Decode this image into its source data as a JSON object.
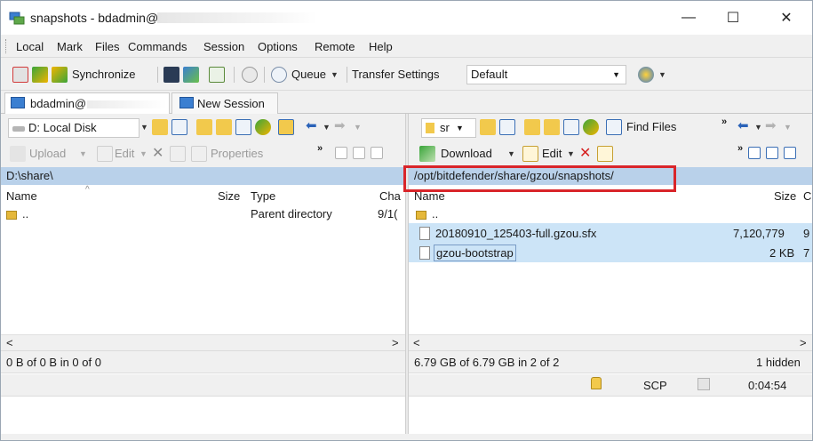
{
  "window": {
    "title": "snapshots - bdadmin@",
    "controls": [
      "—",
      "☐",
      "✕"
    ]
  },
  "menu": [
    "Local",
    "Mark",
    "Files",
    "Commands",
    "Session",
    "Options",
    "Remote",
    "Help"
  ],
  "toolbar": {
    "synchronize": "Synchronize",
    "queue": "Queue",
    "transfer_settings_label": "Transfer Settings",
    "transfer_settings_value": "Default"
  },
  "tabs": {
    "session": "bdadmin@",
    "new_session": "New Session"
  },
  "left": {
    "drive": "D: Local Disk",
    "upload": "Upload",
    "edit": "Edit",
    "properties": "Properties",
    "path": "D:\\share\\",
    "columns": {
      "name": "Name",
      "size": "Size",
      "type": "Type",
      "changed": "Cha"
    },
    "rows": [
      {
        "name": "..",
        "size": "",
        "type": "Parent directory",
        "changed": "9/1("
      }
    ],
    "status": "0 B of 0 B in 0 of 0"
  },
  "right": {
    "dir": "sr",
    "find_files": "Find Files",
    "download": "Download",
    "edit": "Edit",
    "path": "/opt/bitdefender/share/gzou/snapshots/",
    "columns": {
      "name": "Name",
      "size": "Size",
      "changed": "C"
    },
    "rows": [
      {
        "name": "..",
        "size": "",
        "changed": ""
      },
      {
        "name": "20180910_125403-full.gzou.sfx",
        "size": "7,120,779",
        "changed": "9"
      },
      {
        "name": "gzou-bootstrap",
        "size": "2 KB",
        "changed": "7"
      }
    ],
    "status": "6.79 GB of 6.79 GB in 2 of 2",
    "hidden": "1 hidden"
  },
  "statusbar": {
    "protocol": "SCP",
    "time": "0:04:54"
  },
  "scroll": {
    "left": "<",
    "right": ">"
  },
  "colors": {
    "path_bar": "#b9d1ea",
    "selection": "#cce4f7",
    "highlight": "#d9252a"
  }
}
